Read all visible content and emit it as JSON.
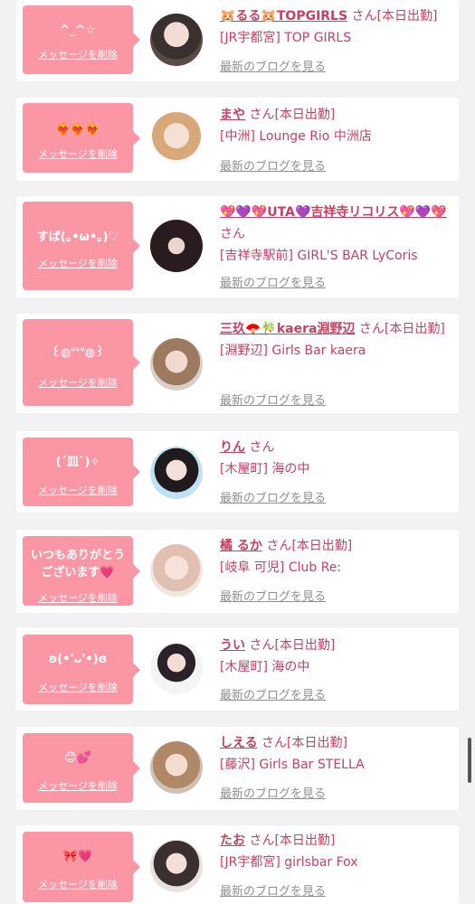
{
  "items": [
    {
      "message": "^_^☆",
      "delete_label": "メッセージを削除",
      "name": "🐹るる🐹TOPGIRLS",
      "suffix": "さん[本日出勤]",
      "shop": "[JR宇都宮] TOP GIRLS",
      "blog_label": "最新のブログを見る"
    },
    {
      "message": "❤️‍🔥❤️‍🔥❤️‍🔥",
      "delete_label": "メッセージを削除",
      "name": "まや",
      "suffix": "さん[本日出勤]",
      "shop": "[中洲] Lounge Rio 中洲店",
      "blog_label": "最新のブログを見る"
    },
    {
      "message": "すば(｡•ω•｡)♡",
      "delete_label": "メッセージを削除",
      "name": "💖💜💖UTA💜吉祥寺リコリス💖💜💖",
      "suffix": "さん",
      "shop": "[吉祥寺駅前] GIRL'S BAR LyCoris",
      "blog_label": "最新のブログを見る"
    },
    {
      "message": "꒰◍ᐡᐤᐡ◍꒱",
      "delete_label": "メッセージを削除",
      "name": "三玖🪭🎋kaera淵野辺",
      "suffix": "さん[本日出勤]",
      "shop": "[淵野辺] Girls Bar kaera",
      "blog_label": "最新のブログを見る"
    },
    {
      "message": "(ˊ皿ˋ)✧",
      "delete_label": "メッセージを削除",
      "name": "りん",
      "suffix": "さん",
      "shop": "[木屋町] 海の中",
      "blog_label": "最新のブログを見る"
    },
    {
      "message": "いつもありがとうございます💗",
      "delete_label": "メッセージを削除",
      "name": "橘 るか",
      "suffix": "さん[本日出勤]",
      "shop": "[岐阜 可児] Club Re:",
      "blog_label": "最新のブログを見る"
    },
    {
      "message": "ʚ(•'ᴗ'•)ɞ",
      "delete_label": "メッセージを削除",
      "name": "うい",
      "suffix": "さん[本日出勤]",
      "shop": "[木屋町] 海の中",
      "blog_label": "最新のブログを見る"
    },
    {
      "message": "😊💕",
      "delete_label": "メッセージを削除",
      "name": "しえる",
      "suffix": "さん[本日出勤]",
      "shop": "[藤沢] Girls Bar STELLA",
      "blog_label": "最新のブログを見る"
    },
    {
      "message": "🎀💗",
      "delete_label": "メッセージを削除",
      "name": "たお",
      "suffix": "さん[本日出勤]",
      "shop": "[JR宇都宮] girlsbar Fox",
      "blog_label": "最新のブログを見る"
    }
  ],
  "colors": {
    "bubble": "#fb97a5",
    "name": "#c83f62",
    "link_gray": "#909090",
    "background": "#f2f2f2"
  }
}
